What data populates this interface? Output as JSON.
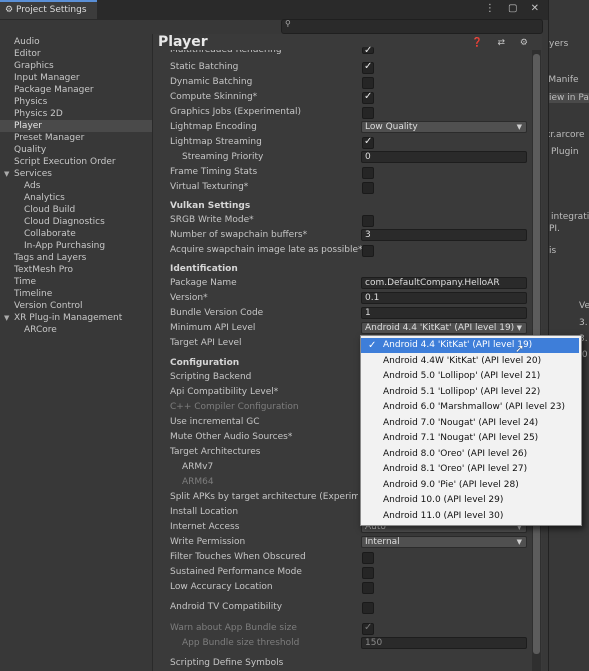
{
  "window": {
    "title": "Project Settings",
    "controls": "⋮ ▢ ✕"
  },
  "background_editor": {
    "tab_label": "yers",
    "manifest_text": "' Manife",
    "view_btn": "iew in Pa",
    "arcore": "xr.arcore",
    "plugin": "Plugin",
    "integration": "integratio",
    "pi": "PI.",
    "is": "is",
    "ve": "Ve",
    "n3a": "3.",
    "n3b": "3.",
    "n0": ".0"
  },
  "sidebar": {
    "items": [
      {
        "label": "Audio"
      },
      {
        "label": "Editor"
      },
      {
        "label": "Graphics"
      },
      {
        "label": "Input Manager"
      },
      {
        "label": "Package Manager"
      },
      {
        "label": "Physics"
      },
      {
        "label": "Physics 2D"
      },
      {
        "label": "Player"
      },
      {
        "label": "Preset Manager"
      },
      {
        "label": "Quality"
      },
      {
        "label": "Script Execution Order"
      },
      {
        "label": "Services"
      },
      {
        "label": "Ads"
      },
      {
        "label": "Analytics"
      },
      {
        "label": "Cloud Build"
      },
      {
        "label": "Cloud Diagnostics"
      },
      {
        "label": "Collaborate"
      },
      {
        "label": "In-App Purchasing"
      },
      {
        "label": "Tags and Layers"
      },
      {
        "label": "TextMesh Pro"
      },
      {
        "label": "Time"
      },
      {
        "label": "Timeline"
      },
      {
        "label": "Version Control"
      },
      {
        "label": "XR Plug-in Management"
      },
      {
        "label": "ARCore"
      }
    ]
  },
  "main": {
    "title": "Player",
    "header_icons": "❓ ⇄ ⚙",
    "rows": {
      "multithreaded": "Multithreaded Rendering",
      "static_batching": "Static Batching",
      "dynamic_batching": "Dynamic Batching",
      "compute_skinning": "Compute Skinning*",
      "graphics_jobs": "Graphics Jobs (Experimental)",
      "lightmap_encoding": "Lightmap Encoding",
      "lightmap_encoding_value": "Low Quality",
      "lightmap_streaming": "Lightmap Streaming",
      "streaming_priority": "Streaming Priority",
      "streaming_priority_value": "0",
      "frame_timing": "Frame Timing Stats",
      "virtual_texturing": "Virtual Texturing*",
      "vulkan_settings": "Vulkan Settings",
      "srgb_write": "SRGB Write Mode*",
      "swapchain_buffers": "Number of swapchain buffers*",
      "swapchain_buffers_value": "3",
      "acquire_swapchain": "Acquire swapchain image late as possible*",
      "identification": "Identification",
      "package_name": "Package Name",
      "package_name_value": "com.DefaultCompany.HelloAR",
      "version": "Version*",
      "version_value": "0.1",
      "bundle_version": "Bundle Version Code",
      "bundle_version_value": "1",
      "min_api": "Minimum API Level",
      "min_api_value": "Android 4.4 'KitKat' (API level 19)",
      "target_api": "Target API Level",
      "configuration": "Configuration",
      "scripting_backend": "Scripting Backend",
      "api_compat": "Api Compatibility Level*",
      "cpp_compiler": "C++ Compiler Configuration",
      "incremental_gc": "Use incremental GC",
      "mute_audio": "Mute Other Audio Sources*",
      "target_arch": "Target Architectures",
      "armv7": "ARMv7",
      "arm64": "ARM64",
      "split_apks": "Split APKs by target architecture (Experimen",
      "install_location": "Install Location",
      "internet_access": "Internet Access",
      "internet_access_value": "Auto",
      "write_permission": "Write Permission",
      "write_permission_value": "Internal",
      "filter_touches": "Filter Touches When Obscured",
      "sustained_perf": "Sustained Performance Mode",
      "low_accuracy": "Low Accuracy Location",
      "android_tv": "Android TV Compatibility",
      "warn_bundle": "Warn about App Bundle size",
      "bundle_threshold": "App Bundle size threshold",
      "bundle_threshold_value": "150",
      "scripting_defines": "Scripting Define Symbols"
    }
  },
  "popup": {
    "options": [
      {
        "label": "Android 4.4 'KitKat' (API level 19)",
        "selected": true
      },
      {
        "label": "Android 4.4W 'KitKat' (API level 20)"
      },
      {
        "label": "Android 5.0 'Lollipop' (API level 21)"
      },
      {
        "label": "Android 5.1 'Lollipop' (API level 22)"
      },
      {
        "label": "Android 6.0 'Marshmallow' (API level 23)"
      },
      {
        "label": "Android 7.0 'Nougat' (API level 24)"
      },
      {
        "label": "Android 7.1 'Nougat' (API level 25)"
      },
      {
        "label": "Android 8.0 'Oreo' (API level 26)"
      },
      {
        "label": "Android 8.1 'Oreo' (API level 27)"
      },
      {
        "label": "Android 9.0 'Pie' (API level 28)"
      },
      {
        "label": "Android 10.0 (API level 29)"
      },
      {
        "label": "Android 11.0 (API level 30)"
      }
    ]
  },
  "colors": {
    "selection": "#3e7ed9",
    "panel": "#383838",
    "title_accent": "#5a8fd6"
  }
}
